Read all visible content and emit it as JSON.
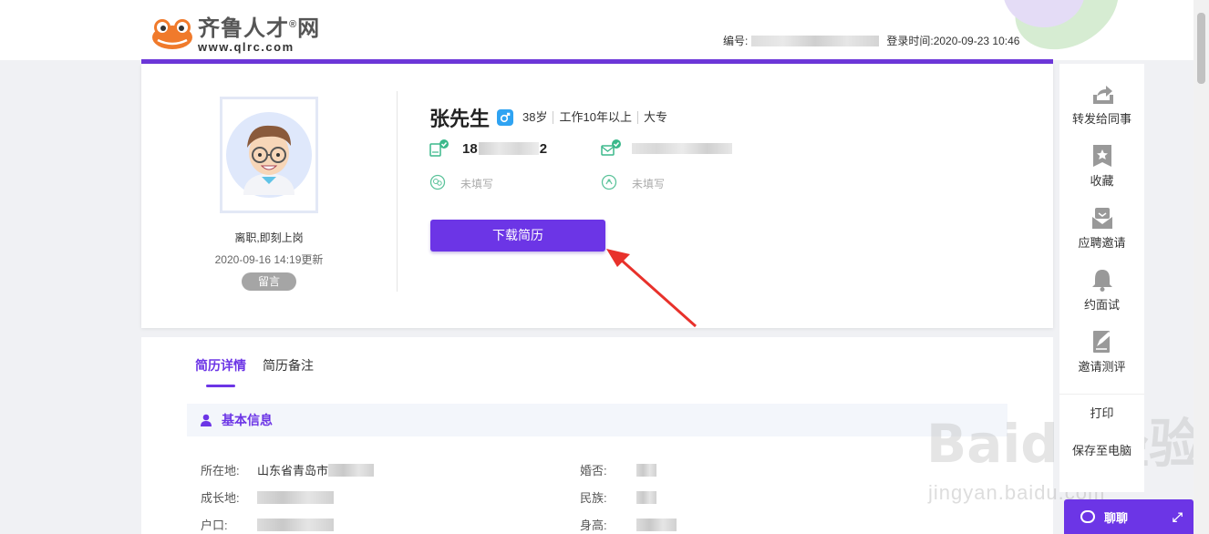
{
  "header": {
    "logo_cn": "齐鲁人才",
    "logo_cn2": "网",
    "logo_reg": "®",
    "logo_url": "www.qlrc.com",
    "id_label": "编号:",
    "login_label": "登录时间:",
    "login_time": "2020-09-23 10:46"
  },
  "profile": {
    "status": "离职,即刻上岗",
    "updated": "2020-09-16 14:19更新",
    "message_button": "留言",
    "name": "张先生",
    "age": "38岁",
    "experience": "工作10年以上",
    "education": "大专",
    "phone_prefix": "18",
    "phone_suffix": "2",
    "wechat": "未填写",
    "qq": "未填写",
    "download_button": "下载简历"
  },
  "tabs": [
    {
      "label": "简历详情",
      "active": true
    },
    {
      "label": "简历备注",
      "active": false
    }
  ],
  "section": {
    "title": "基本信息"
  },
  "fields": {
    "location_label": "所在地:",
    "location_value": "山东省青岛市",
    "grew_label": "成长地:",
    "hukou_label": "户口:",
    "marriage_label": "婚否:",
    "ethnicity_label": "民族:",
    "height_label": "身高:"
  },
  "sidebar": {
    "items": [
      {
        "label": "转发给同事",
        "icon": "share-icon"
      },
      {
        "label": "收藏",
        "icon": "star-icon"
      },
      {
        "label": "应聘邀请",
        "icon": "invite-icon"
      },
      {
        "label": "约面试",
        "icon": "bell-icon"
      },
      {
        "label": "邀请测评",
        "icon": "edit-icon"
      }
    ],
    "print": "打印",
    "save": "保存至电脑"
  },
  "chat": {
    "label": "聊聊"
  },
  "watermark": {
    "main": "Baidu经验",
    "sub": "jingyan.baidu.com"
  },
  "colors": {
    "accent": "#6c35e6",
    "arrow": "#e8312b"
  }
}
